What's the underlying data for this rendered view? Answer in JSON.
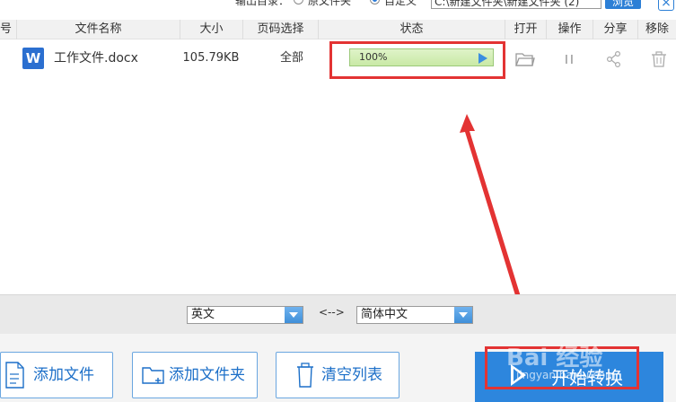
{
  "topbar": {
    "output_label": "输出目录：",
    "opt_source": "原文件夹",
    "opt_custom": "自定义",
    "path_value": "C:\\新建文件夹\\新建文件夹 (2)",
    "browse_label": "浏览",
    "close_label": "×"
  },
  "table": {
    "columns": [
      "号",
      "文件名称",
      "大小",
      "页码选择",
      "状态",
      "打开",
      "操作",
      "分享",
      "移除"
    ],
    "rows": [
      {
        "file_icon": "W",
        "name": "工作文件.docx",
        "size": "105.79KB",
        "pages": "全部",
        "progress_label": "100%",
        "progress": 1.0
      }
    ]
  },
  "lang": {
    "source": "英文",
    "swap": "<-->",
    "target": "简体中文"
  },
  "buttons": {
    "add_file": "添加文件",
    "add_folder": "添加文件夹",
    "clear_list": "清空列表",
    "start": "开始转换"
  },
  "watermark": {
    "brand": "Bai 经验",
    "url": "jingyan.baidu.com"
  },
  "colors": {
    "accent": "#2d86dd",
    "highlight": "#e33333",
    "progress": "#c9e9a6"
  }
}
